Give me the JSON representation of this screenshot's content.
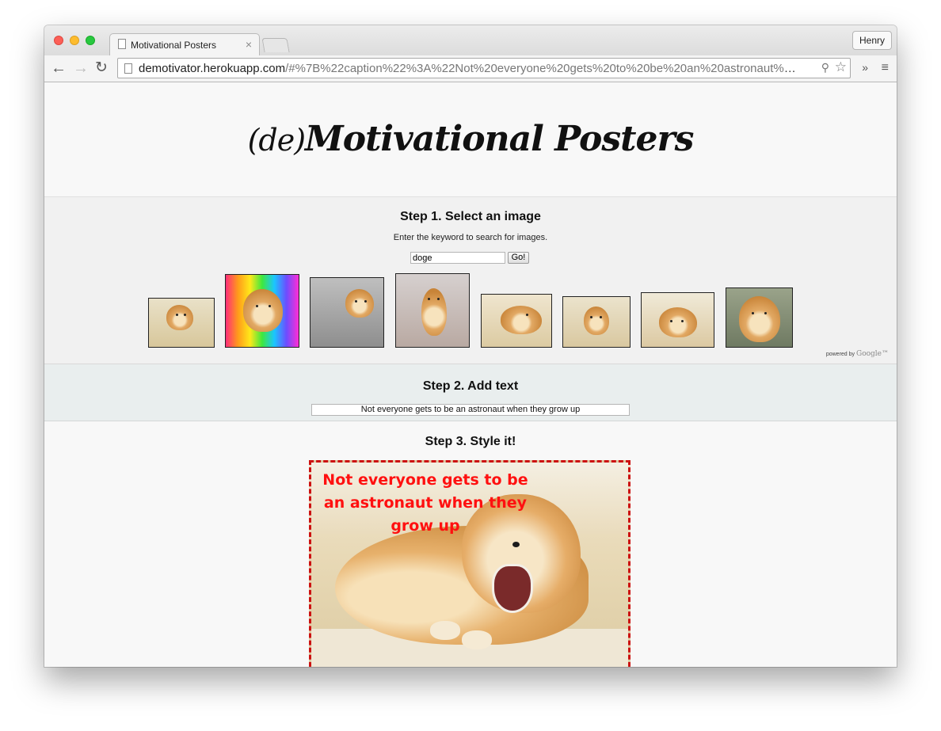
{
  "browser": {
    "tab_title": "Motivational Posters",
    "tab_close": "×",
    "profile_name": "Henry",
    "url_host": "demotivator.herokuapp.com",
    "url_path": "/#%7B%22caption%22%3A%22Not%20everyone%20gets%20to%20be%20an%20astronaut%20...",
    "back_icon": "←",
    "forward_icon": "→",
    "reload_icon": "↻",
    "extensions_icon": "»",
    "menu_icon": "≡",
    "search_icon": "⚲",
    "star_icon": "☆",
    "page_action_icon": "▯"
  },
  "site": {
    "title_prefix": "(de)",
    "title_main": "Motivational Posters"
  },
  "step1": {
    "title": "Step 1. Select an image",
    "helper": "Enter the keyword to search for images.",
    "search_value": "doge",
    "go_label": "Go!",
    "powered_by": "powered by",
    "google": "Google™",
    "thumbnails": [
      {
        "name": "doge-couch"
      },
      {
        "name": "doge-rainbow"
      },
      {
        "name": "doge-much-wow"
      },
      {
        "name": "doge-hat"
      },
      {
        "name": "doge-yell"
      },
      {
        "name": "doge-bowtie"
      },
      {
        "name": "doge-petted"
      },
      {
        "name": "doge-smile"
      }
    ]
  },
  "step2": {
    "title": "Step 2. Add text",
    "caption": "Not everyone gets to be an astronaut when they grow up"
  },
  "step3": {
    "title": "Step 3. Style it!",
    "poster_text": "Not everyone gets to be an astronaut when they grow up",
    "text_color": "#ff1010",
    "border_color": "#cc1111"
  }
}
